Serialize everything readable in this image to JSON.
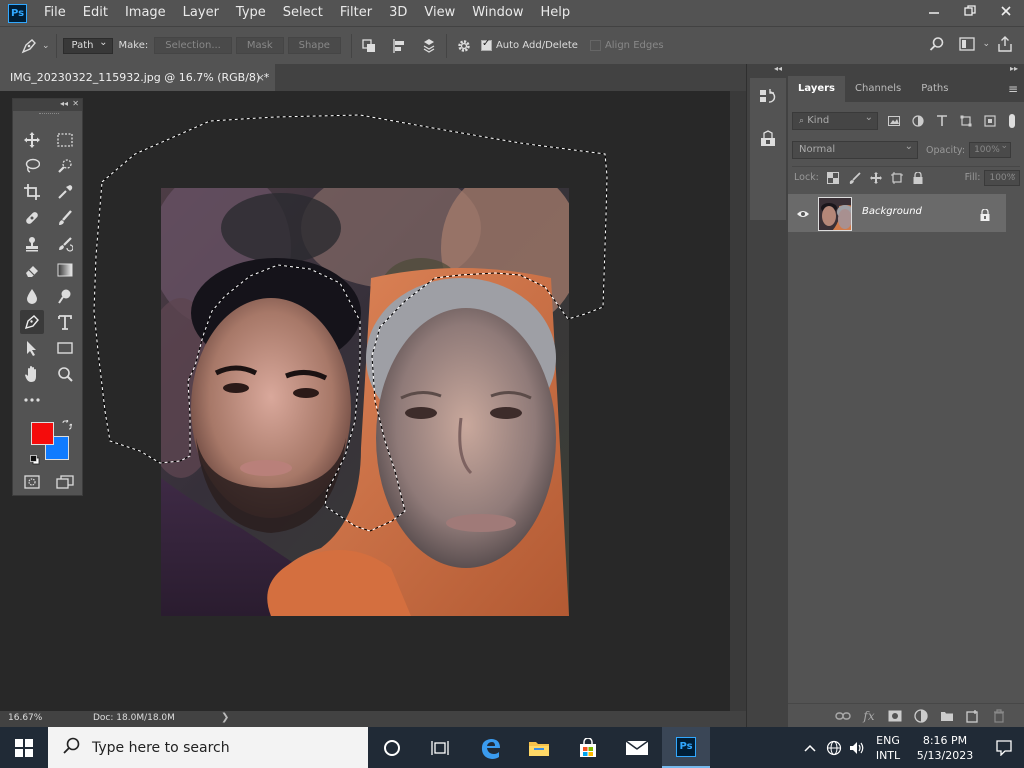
{
  "app": {
    "logo": "Ps",
    "menus": [
      "File",
      "Edit",
      "Image",
      "Layer",
      "Type",
      "Select",
      "Filter",
      "3D",
      "View",
      "Window",
      "Help"
    ],
    "window_controls": [
      "minimize-icon",
      "restore-icon",
      "close-icon"
    ]
  },
  "options_bar": {
    "tool_mode": "Path",
    "make_label": "Make:",
    "make_buttons": [
      "Selection...",
      "Mask",
      "Shape"
    ],
    "auto_add_delete": {
      "label": "Auto Add/Delete",
      "checked": true
    },
    "align_edges": {
      "label": "Align Edges",
      "checked": false
    }
  },
  "document": {
    "tab_title": "IMG_20230322_115932.jpg @ 16.7% (RGB/8) *",
    "close_glyph": "×"
  },
  "status": {
    "zoom": "16.67%",
    "doc_size": "Doc: 18.0M/18.0M",
    "arrow": "❯"
  },
  "toolbar": {
    "collapse": "◂◂",
    "close": "✕",
    "tools": [
      "move-tool-icon",
      "marquee-tool-icon",
      "lasso-tool-icon",
      "quick-select-tool-icon",
      "crop-tool-icon",
      "eyedropper-tool-icon",
      "healing-brush-tool-icon",
      "brush-tool-icon",
      "clone-stamp-tool-icon",
      "history-brush-tool-icon",
      "eraser-tool-icon",
      "gradient-tool-icon",
      "blur-tool-icon",
      "dodge-tool-icon",
      "pen-tool-icon",
      "type-tool-icon",
      "path-selection-tool-icon",
      "rectangle-tool-icon",
      "hand-tool-icon",
      "zoom-tool-icon",
      "edit-toolbar-icon"
    ],
    "active_tool": "pen-tool-icon",
    "foreground_color": "#f50c0c",
    "background_color": "#0f7bff"
  },
  "layers_panel": {
    "tabs": [
      "Layers",
      "Channels",
      "Paths"
    ],
    "active_tab": "Layers",
    "filter_kind": "Kind",
    "blend_mode": "Normal",
    "opacity_label": "Opacity:",
    "opacity_value": "100%",
    "lock_label": "Lock:",
    "fill_label": "Fill:",
    "fill_value": "100%",
    "layers": [
      {
        "name": "Background",
        "visible": true,
        "locked": true
      }
    ]
  },
  "taskbar": {
    "search_placeholder": "Type here to search",
    "language": [
      "ENG",
      "INTL"
    ],
    "time": "8:16 PM",
    "date": "5/13/2023"
  }
}
